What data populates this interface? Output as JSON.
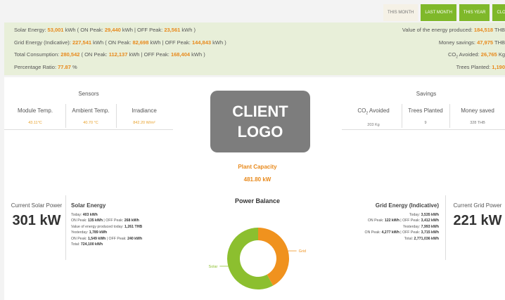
{
  "tabs": [
    {
      "label": "THIS MONTH",
      "active": false
    },
    {
      "label": "LAST MONTH",
      "active": true
    },
    {
      "label": "THIS YEAR",
      "active": true
    },
    {
      "label": "CLOS",
      "active": true
    }
  ],
  "summary": {
    "solar": {
      "label": "Solar Energy: ",
      "total": "53,001",
      "unit": " kWh ( ON Peak: ",
      "on_peak": "29,440",
      "mid": " kWh | OFF Peak: ",
      "off_peak": "23,561",
      "end": " kWh )"
    },
    "grid": {
      "label": "Grid Energy (Indicative): ",
      "total": "227,541",
      "unit": " kWh ( ON Peak: ",
      "on_peak": "82,698",
      "mid": " kWh | OFF Peak: ",
      "off_peak": "144,843",
      "end": " kWh )"
    },
    "consumption": {
      "label": "Total Consumption: ",
      "total": "280,542",
      "unit": " ( ON Peak: ",
      "on_peak": "112,137",
      "mid": " kWh | OFF Peak: ",
      "off_peak": "168,404",
      "end": " kWh )"
    },
    "ratio": {
      "label": "Percentage Ratio: ",
      "value": "77.87",
      "unit": " %"
    },
    "value_produced": {
      "label": "Value of the energy produced: ",
      "value": "184,518",
      "unit": " THB"
    },
    "money_savings": {
      "label": "Money savings: ",
      "value": "47,975",
      "unit": " THB"
    },
    "co2_avoided": {
      "label_pre": "CO",
      "label_sub": "2",
      "label_post": " Avoided: ",
      "value": "26,765",
      "unit": " Kg"
    },
    "trees_planted": {
      "label": "Trees Planted: ",
      "value": "1,190"
    }
  },
  "sensors": {
    "title": "Sensors",
    "items": [
      {
        "label": "Module Temp.",
        "value": "43.11°C"
      },
      {
        "label": "Ambient Temp.",
        "value": "40.70 °C"
      },
      {
        "label": "Irradiance",
        "value": "842.20 W/m²"
      }
    ]
  },
  "logo": {
    "line1": "CLIENT",
    "line2": "LOGO"
  },
  "savings": {
    "title": "Savings",
    "co2_pre": "CO",
    "co2_sub": "2",
    "co2_post": " Avoided",
    "co2_value": "203 Kg",
    "trees_label": "Trees Planted",
    "trees_value": "9",
    "money_label": "Money saved",
    "money_value": "328 THB"
  },
  "plant_capacity": {
    "label": "Plant Capacity",
    "value": "481.80 kW"
  },
  "current_solar": {
    "label": "Current Solar Power",
    "value": "301 kW"
  },
  "current_grid": {
    "label": "Current Grid Power",
    "value": "221 kW"
  },
  "solar_energy": {
    "title": "Solar Energy",
    "today_label": "Today: ",
    "today": "403 kWh",
    "today_on_label": "ON Peak: ",
    "today_on": "135 kWh",
    "today_off_label": " | OFF Peak: ",
    "today_off": "268 kWh",
    "value_today_label": "Value of energy produced today: ",
    "value_today": "1,261 THB",
    "yesterday_label": "Yesterday: ",
    "yesterday": "1,789 kWh",
    "y_on_label": "ON Peak: ",
    "y_on": "1,549 kWh",
    "y_off_label": " | OFF Peak: ",
    "y_off": "240 kWh",
    "total_label": "Total: ",
    "total": "724,100 kWh"
  },
  "grid_energy": {
    "title": "Grid Energy (Indicative)",
    "today_label": "Today: ",
    "today": "3,535 kWh",
    "today_on_label": "ON Peak: ",
    "today_on": "122 kWh",
    "today_off_label": " | OFF Peak: ",
    "today_off": "3,412 kWh",
    "yesterday_label": "Yesterday: ",
    "yesterday": "7,993 kWh",
    "y_on_label": "ON Peak: ",
    "y_on": "4,277 kWh",
    "y_off_label": " | OFF Peak: ",
    "y_off": "3,715 kWh",
    "total_label": "Total: ",
    "total": "2,771,036 kWh"
  },
  "power_balance": {
    "title": "Power Balance",
    "slices": [
      {
        "name": "Grid",
        "fraction": 0.42,
        "color": "#f0921e"
      },
      {
        "name": "Solar",
        "fraction": 0.58,
        "color": "#8cbf2f"
      }
    ]
  }
}
